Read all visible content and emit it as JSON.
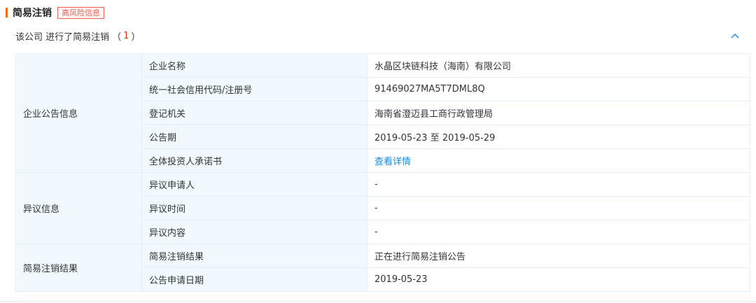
{
  "section": {
    "title": "简易注销",
    "badge": "高风险信息"
  },
  "summary": {
    "text": "该公司 进行了简易注销",
    "open_paren": "（",
    "count": "1",
    "close_paren": "）"
  },
  "groups": {
    "notice": "企业公告信息",
    "objection": "异议信息",
    "result": "简易注销结果"
  },
  "rows": [
    {
      "label": "企业名称",
      "value": "水晶区块链科技（海南）有限公司"
    },
    {
      "label": "统一社会信用代码/注册号",
      "value": "91469027MA5T7DML8Q"
    },
    {
      "label": "登记机关",
      "value": "海南省澄迈县工商行政管理局"
    },
    {
      "label": "公告期",
      "value": "2019-05-23 至 2019-05-29"
    },
    {
      "label": "全体投资人承诺书",
      "value": "查看详情"
    },
    {
      "label": "异议申请人",
      "value": "-"
    },
    {
      "label": "异议时间",
      "value": "-"
    },
    {
      "label": "异议内容",
      "value": "-"
    },
    {
      "label": "简易注销结果",
      "value": "正在进行简易注销公告"
    },
    {
      "label": "公告申请日期",
      "value": "2019-05-23"
    }
  ],
  "colors": {
    "accent": "#ff6a00",
    "badge": "#f55d4d",
    "count": "#e2350c",
    "link": "#128bed",
    "label_bg": "#f2f9fc",
    "border": "#e4eef6"
  },
  "icons": {
    "collapse": "chevron-up-icon"
  }
}
